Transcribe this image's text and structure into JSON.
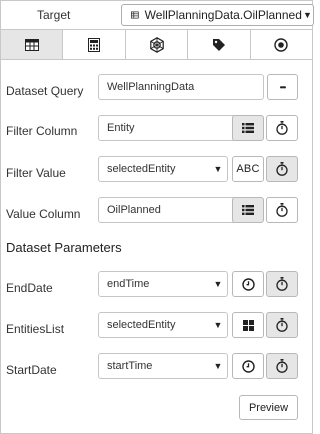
{
  "target": {
    "label": "Target",
    "selected": "WellPlanningData.OilPlanned",
    "icon": "table-icon"
  },
  "tabs": [
    {
      "icon": "table-icon",
      "active": true
    },
    {
      "icon": "calculator-icon",
      "active": false
    },
    {
      "icon": "gear-wheel-icon",
      "active": false
    },
    {
      "icon": "tag-icon",
      "active": false
    },
    {
      "icon": "radio-target-icon",
      "active": false
    }
  ],
  "form": {
    "dataset_query": {
      "label": "Dataset Query",
      "value": "WellPlanningData",
      "more_label": "•••"
    },
    "filter_column": {
      "label": "Filter Column",
      "value": "Entity"
    },
    "filter_value": {
      "label": "Filter Value",
      "value": "selectedEntity",
      "type_label": "ABC"
    },
    "value_column": {
      "label": "Value Column",
      "value": "OilPlanned"
    }
  },
  "dataset_parameters": {
    "title": "Dataset Parameters",
    "params": [
      {
        "label": "EndDate",
        "value": "endTime",
        "type_icon": "clock-icon"
      },
      {
        "label": "EntitiesList",
        "value": "selectedEntity",
        "type_icon": "grid-icon"
      },
      {
        "label": "StartDate",
        "value": "startTime",
        "type_icon": "clock-icon"
      }
    ]
  },
  "preview_label": "Preview",
  "colors": {
    "border": "#c8c8c8",
    "active_bg": "#e6e6e6",
    "text": "#333333"
  }
}
